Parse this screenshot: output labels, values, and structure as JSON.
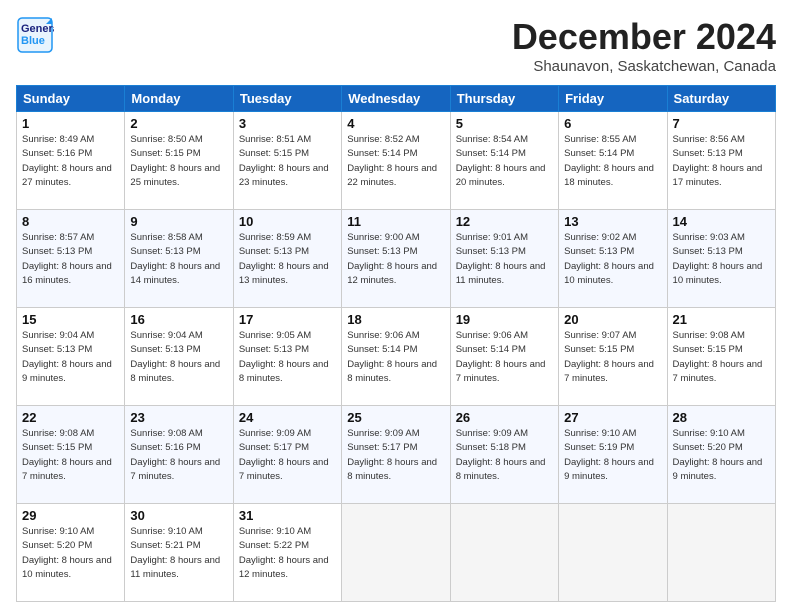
{
  "header": {
    "logo_line1": "General",
    "logo_line2": "Blue",
    "month": "December 2024",
    "location": "Shaunavon, Saskatchewan, Canada"
  },
  "weekdays": [
    "Sunday",
    "Monday",
    "Tuesday",
    "Wednesday",
    "Thursday",
    "Friday",
    "Saturday"
  ],
  "weeks": [
    [
      {
        "day": "1",
        "sunrise": "8:49 AM",
        "sunset": "5:16 PM",
        "daylight": "8 hours and 27 minutes."
      },
      {
        "day": "2",
        "sunrise": "8:50 AM",
        "sunset": "5:15 PM",
        "daylight": "8 hours and 25 minutes."
      },
      {
        "day": "3",
        "sunrise": "8:51 AM",
        "sunset": "5:15 PM",
        "daylight": "8 hours and 23 minutes."
      },
      {
        "day": "4",
        "sunrise": "8:52 AM",
        "sunset": "5:14 PM",
        "daylight": "8 hours and 22 minutes."
      },
      {
        "day": "5",
        "sunrise": "8:54 AM",
        "sunset": "5:14 PM",
        "daylight": "8 hours and 20 minutes."
      },
      {
        "day": "6",
        "sunrise": "8:55 AM",
        "sunset": "5:14 PM",
        "daylight": "8 hours and 18 minutes."
      },
      {
        "day": "7",
        "sunrise": "8:56 AM",
        "sunset": "5:13 PM",
        "daylight": "8 hours and 17 minutes."
      }
    ],
    [
      {
        "day": "8",
        "sunrise": "8:57 AM",
        "sunset": "5:13 PM",
        "daylight": "8 hours and 16 minutes."
      },
      {
        "day": "9",
        "sunrise": "8:58 AM",
        "sunset": "5:13 PM",
        "daylight": "8 hours and 14 minutes."
      },
      {
        "day": "10",
        "sunrise": "8:59 AM",
        "sunset": "5:13 PM",
        "daylight": "8 hours and 13 minutes."
      },
      {
        "day": "11",
        "sunrise": "9:00 AM",
        "sunset": "5:13 PM",
        "daylight": "8 hours and 12 minutes."
      },
      {
        "day": "12",
        "sunrise": "9:01 AM",
        "sunset": "5:13 PM",
        "daylight": "8 hours and 11 minutes."
      },
      {
        "day": "13",
        "sunrise": "9:02 AM",
        "sunset": "5:13 PM",
        "daylight": "8 hours and 10 minutes."
      },
      {
        "day": "14",
        "sunrise": "9:03 AM",
        "sunset": "5:13 PM",
        "daylight": "8 hours and 10 minutes."
      }
    ],
    [
      {
        "day": "15",
        "sunrise": "9:04 AM",
        "sunset": "5:13 PM",
        "daylight": "8 hours and 9 minutes."
      },
      {
        "day": "16",
        "sunrise": "9:04 AM",
        "sunset": "5:13 PM",
        "daylight": "8 hours and 8 minutes."
      },
      {
        "day": "17",
        "sunrise": "9:05 AM",
        "sunset": "5:13 PM",
        "daylight": "8 hours and 8 minutes."
      },
      {
        "day": "18",
        "sunrise": "9:06 AM",
        "sunset": "5:14 PM",
        "daylight": "8 hours and 8 minutes."
      },
      {
        "day": "19",
        "sunrise": "9:06 AM",
        "sunset": "5:14 PM",
        "daylight": "8 hours and 7 minutes."
      },
      {
        "day": "20",
        "sunrise": "9:07 AM",
        "sunset": "5:15 PM",
        "daylight": "8 hours and 7 minutes."
      },
      {
        "day": "21",
        "sunrise": "9:08 AM",
        "sunset": "5:15 PM",
        "daylight": "8 hours and 7 minutes."
      }
    ],
    [
      {
        "day": "22",
        "sunrise": "9:08 AM",
        "sunset": "5:15 PM",
        "daylight": "8 hours and 7 minutes."
      },
      {
        "day": "23",
        "sunrise": "9:08 AM",
        "sunset": "5:16 PM",
        "daylight": "8 hours and 7 minutes."
      },
      {
        "day": "24",
        "sunrise": "9:09 AM",
        "sunset": "5:17 PM",
        "daylight": "8 hours and 7 minutes."
      },
      {
        "day": "25",
        "sunrise": "9:09 AM",
        "sunset": "5:17 PM",
        "daylight": "8 hours and 8 minutes."
      },
      {
        "day": "26",
        "sunrise": "9:09 AM",
        "sunset": "5:18 PM",
        "daylight": "8 hours and 8 minutes."
      },
      {
        "day": "27",
        "sunrise": "9:10 AM",
        "sunset": "5:19 PM",
        "daylight": "8 hours and 9 minutes."
      },
      {
        "day": "28",
        "sunrise": "9:10 AM",
        "sunset": "5:20 PM",
        "daylight": "8 hours and 9 minutes."
      }
    ],
    [
      {
        "day": "29",
        "sunrise": "9:10 AM",
        "sunset": "5:20 PM",
        "daylight": "8 hours and 10 minutes."
      },
      {
        "day": "30",
        "sunrise": "9:10 AM",
        "sunset": "5:21 PM",
        "daylight": "8 hours and 11 minutes."
      },
      {
        "day": "31",
        "sunrise": "9:10 AM",
        "sunset": "5:22 PM",
        "daylight": "8 hours and 12 minutes."
      },
      null,
      null,
      null,
      null
    ]
  ],
  "labels": {
    "sunrise": "Sunrise:",
    "sunset": "Sunset:",
    "daylight": "Daylight:"
  }
}
